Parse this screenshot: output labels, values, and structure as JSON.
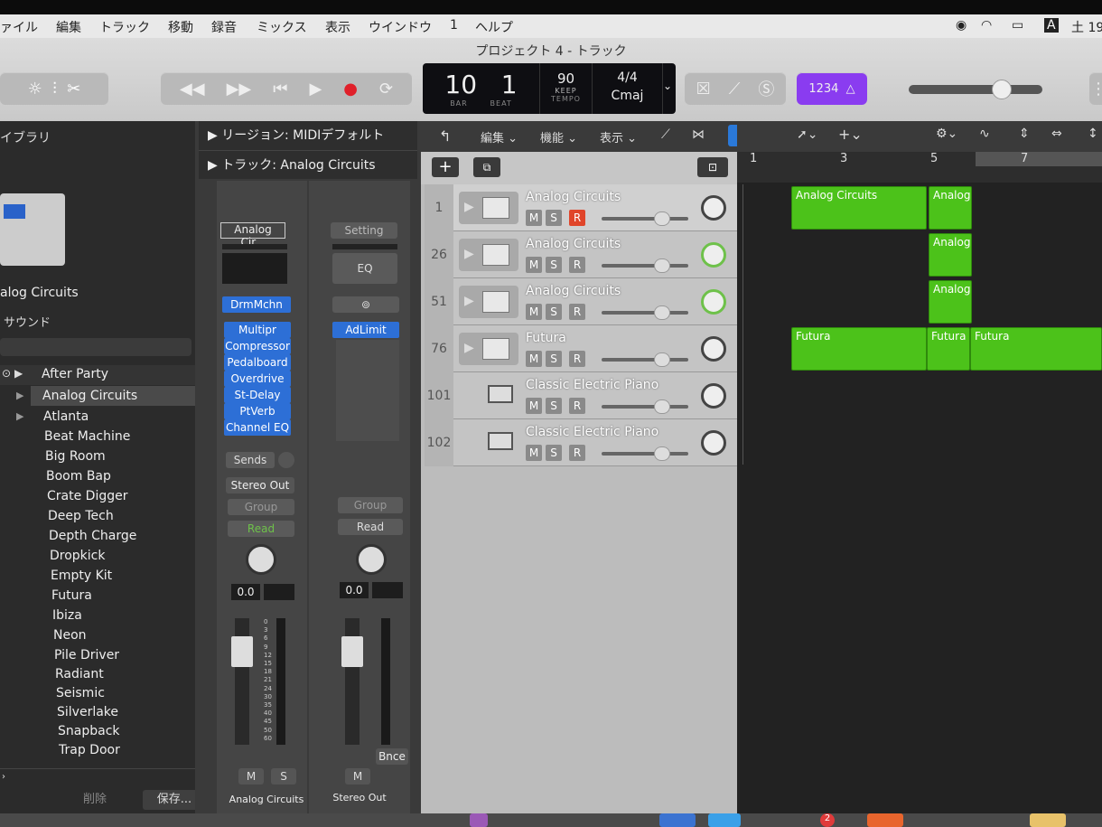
{
  "menubar": {
    "items": [
      "ァイル",
      "編集",
      "トラック",
      "移動",
      "録音",
      "ミックス",
      "表示",
      "ウインドウ",
      "1",
      "ヘルプ"
    ],
    "clock": "土 19"
  },
  "window": {
    "title": "プロジェクト 4 - トラック"
  },
  "lcd": {
    "bar": "10",
    "beat": "1",
    "bar_label": "BAR",
    "beat_label": "BEAT",
    "tempo": "90",
    "keep": "KEEP",
    "tempo_label": "TEMPO",
    "signature": "4/4",
    "key": "Cmaj"
  },
  "toolbar": {
    "count_in": "1234"
  },
  "library": {
    "title": "イブラリ",
    "patch_name": "alog Circuits",
    "section": "サウンド",
    "items": [
      "After Party",
      "Analog Circuits",
      "Atlanta",
      "Beat Machine",
      "Big Room",
      "Boom Bap",
      "Crate Digger",
      "Deep Tech",
      "Depth Charge",
      "Dropkick",
      "Empty Kit",
      "Futura",
      "Ibiza",
      "Neon",
      "Pile Driver",
      "Radiant",
      "Seismic",
      "Silverlake",
      "Snapback",
      "Trap Door"
    ],
    "delete_label": "削除",
    "save_label": "保存..."
  },
  "inspector": {
    "region_label": "リージョン: MIDIデフォルト",
    "track_label": "トラック: Analog Circuits",
    "strip1": {
      "instrument": "Analog Cir...",
      "midi_fx": "DrmMchn",
      "plugins": [
        "Multipr",
        "Compressor",
        "Pedalboard",
        "Overdrive",
        "St-Delay",
        "PtVerb",
        "Channel EQ"
      ],
      "sends": "Sends",
      "output": "Stereo Out",
      "group": "Group",
      "automation": "Read",
      "volume": "0.0",
      "name": "Analog Circuits"
    },
    "strip2": {
      "setting": "Setting",
      "eq": "EQ",
      "plugin": "AdLimit",
      "group": "Group",
      "automation": "Read",
      "volume": "0.0",
      "bounce": "Bnce",
      "name": "Stereo Out"
    },
    "meter_scale": [
      "0",
      "3",
      "6",
      "9",
      "12",
      "15",
      "18",
      "21",
      "24",
      "30",
      "35",
      "40",
      "45",
      "50",
      "60"
    ]
  },
  "track_header": {
    "edit": "編集",
    "functions": "機能",
    "view": "表示"
  },
  "tracks": [
    {
      "num": "1",
      "name": "Analog Circuits",
      "record_armed": true
    },
    {
      "num": "26",
      "name": "Analog Circuits",
      "record_armed": false
    },
    {
      "num": "51",
      "name": "Analog Circuits",
      "record_armed": false
    },
    {
      "num": "76",
      "name": "Futura",
      "record_armed": false
    },
    {
      "num": "101",
      "name": "Classic Electric Piano",
      "record_armed": false
    },
    {
      "num": "102",
      "name": "Classic Electric Piano",
      "record_armed": false
    }
  ],
  "msr": {
    "m": "M",
    "s": "S",
    "r": "R"
  },
  "ruler": [
    "1",
    "3",
    "5",
    "7"
  ],
  "regions": [
    {
      "label": "Analog Circuits"
    },
    {
      "label": "Analog"
    },
    {
      "label": "Analog"
    },
    {
      "label": "Analog"
    },
    {
      "label": "Futura"
    },
    {
      "label": "Futura"
    },
    {
      "label": "Futura"
    }
  ],
  "colors": {
    "region": "#4cc21a",
    "plugin": "#2d6fd6",
    "record": "#e0452a",
    "read": "#6ec14a",
    "countin": "#8a3cf0"
  }
}
